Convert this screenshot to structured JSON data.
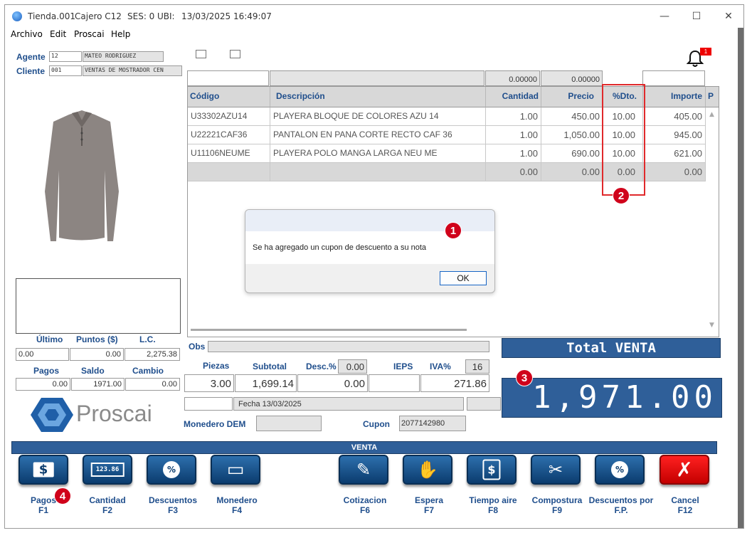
{
  "window": {
    "store": "Tienda.001",
    "cashier": "Cajero C12",
    "session": "SES: 0",
    "ubi": "UBI:",
    "datetime": "13/03/2025 16:49:07"
  },
  "menu": [
    "Archivo",
    "Edit",
    "Proscai",
    "Help"
  ],
  "agent": {
    "label": "Agente",
    "code": "12",
    "name": "MATEO RODRIGUEZ"
  },
  "client": {
    "label": "Cliente",
    "code": "001",
    "name": "VENTAS DE MOSTRADOR CEN"
  },
  "notifications": {
    "count": "1"
  },
  "grid_top": {
    "qty_total": "0.00000",
    "price_total": "0.00000"
  },
  "columns": [
    "Código",
    "Descripción",
    "Cantidad",
    "Precio",
    "%Dto.",
    "Importe",
    "P"
  ],
  "rows": [
    {
      "code": "U33302AZU14",
      "desc": "PLAYERA BLOQUE DE COLORES AZU 14",
      "qty": "1.00",
      "price": "450.00",
      "disc": "10.00",
      "amount": "405.00"
    },
    {
      "code": "U22221CAF36",
      "desc": "PANTALON EN PANA CORTE RECTO CAF 36",
      "qty": "1.00",
      "price": "1,050.00",
      "disc": "10.00",
      "amount": "945.00"
    },
    {
      "code": "U11106NEUME",
      "desc": "PLAYERA POLO MANGA LARGA NEU ME",
      "qty": "1.00",
      "price": "690.00",
      "disc": "10.00",
      "amount": "621.00"
    }
  ],
  "empty_row": {
    "qty": "0.00",
    "price": "0.00",
    "disc": "0.00",
    "amount": "0.00"
  },
  "dialog": {
    "message": "Se ha agregado un cupon de descuento a su nota",
    "ok": "OK"
  },
  "badges": [
    "1",
    "2",
    "3",
    "4"
  ],
  "left_stats": {
    "ultimo_label": "Último",
    "puntos_label": "Puntos ($)",
    "lc_label": "L.C.",
    "ultimo": "0.00",
    "puntos": "0.00",
    "lc": "2,275.38",
    "pagos_label": "Pagos",
    "saldo_label": "Saldo",
    "cambio_label": "Cambio",
    "pagos": "0.00",
    "saldo": "1971.00",
    "cambio": "0.00"
  },
  "logo_text": "Proscai",
  "summary": {
    "obs_label": "Obs",
    "piezas_label": "Piezas",
    "subtotal_label": "Subtotal",
    "desc_label": "Desc.%",
    "desc_pct": "0.00",
    "ieps_label": "IEPS",
    "iva_label": "IVA%",
    "iva_pct": "16",
    "piezas": "3.00",
    "subtotal": "1,699.14",
    "desc_amount": "0.00",
    "iva_amount": "271.86",
    "fecha": "Fecha 13/03/2025",
    "monedero_label": "Monedero DEM",
    "cupon_label": "Cupon",
    "cupon": "2077142980"
  },
  "total": {
    "label": "Total VENTA",
    "amount": "1,971.00"
  },
  "venta_bar": "VENTA",
  "fkeys": [
    {
      "name": "Pagos",
      "key": "F1",
      "icon": "$"
    },
    {
      "name": "Cantidad",
      "key": "F2",
      "icon": "123.86"
    },
    {
      "name": "Descuentos",
      "key": "F3",
      "icon": "%"
    },
    {
      "name": "Monedero",
      "key": "F4",
      "icon": "▭"
    },
    {
      "name": "Cotizacion",
      "key": "F6",
      "icon": "✎"
    },
    {
      "name": "Espera",
      "key": "F7",
      "icon": "✋"
    },
    {
      "name": "Tiempo aire",
      "key": "F8",
      "icon": "$"
    },
    {
      "name": "Compostura",
      "key": "F9",
      "icon": "✂"
    },
    {
      "name": "Descuentos por",
      "name2": "F.P.",
      "icon": "%"
    },
    {
      "name": "Cancel",
      "key": "F12",
      "icon": "✗"
    }
  ]
}
